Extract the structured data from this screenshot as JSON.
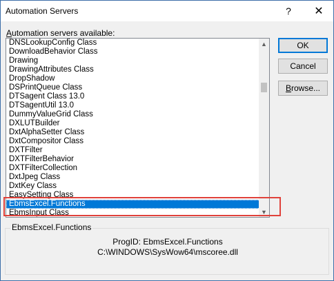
{
  "window": {
    "title": "Automation Servers",
    "help_glyph": "?",
    "close_glyph": "✕"
  },
  "list": {
    "caption_prefix": "A",
    "caption_rest": "utomation servers available:",
    "items": [
      "DNSLookupConfig Class",
      "DownloadBehavior Class",
      "Drawing",
      "DrawingAttributes Class",
      "DropShadow",
      "DSPrintQueue Class",
      "DTSagent Class 13.0",
      "DTSagentUtil 13.0",
      "DummyValueGrid Class",
      "DXLUTBuilder",
      "DxtAlphaSetter Class",
      "DxtCompositor Class",
      "DXTFilter",
      "DXTFilterBehavior",
      "DXTFilterCollection",
      "DxtJpeg Class",
      "DxtKey Class",
      "EasySetting Class",
      "EbmsExcel.Functions",
      "EbmsInput Class"
    ],
    "selected_index": 18,
    "scroll_up_glyph": "▲",
    "scroll_down_glyph": "▼"
  },
  "buttons": {
    "ok": "OK",
    "cancel": "Cancel",
    "browse_prefix": "B",
    "browse_rest": "rowse..."
  },
  "details": {
    "group_label": "EbmsExcel.Functions",
    "progid": "ProgID: EbmsExcel.Functions",
    "path": "C:\\WINDOWS\\SysWow64\\mscoree.dll"
  },
  "colors": {
    "selection": "#0078d7",
    "annotation_box": "#e0413a"
  }
}
